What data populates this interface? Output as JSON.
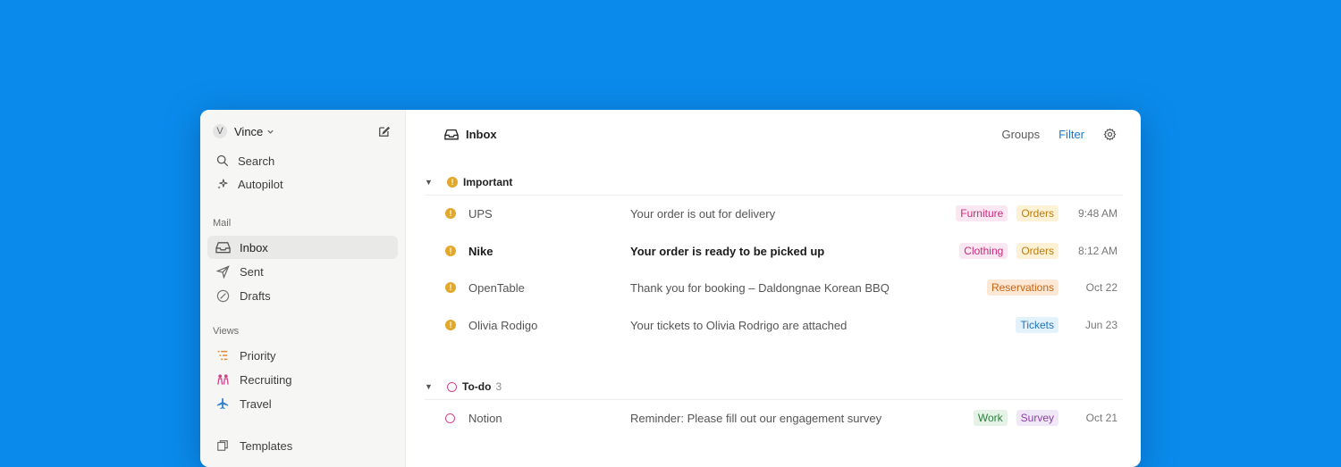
{
  "sidebar": {
    "account_initial": "V",
    "account_name": "Vince",
    "top_items": [
      {
        "label": "Search",
        "icon": "search-icon"
      },
      {
        "label": "Autopilot",
        "icon": "sparkle-icon"
      }
    ],
    "mail_section": "Mail",
    "mail_items": [
      {
        "label": "Inbox",
        "icon": "inbox-icon",
        "active": true
      },
      {
        "label": "Sent",
        "icon": "send-icon"
      },
      {
        "label": "Drafts",
        "icon": "drafts-icon"
      }
    ],
    "views_section": "Views",
    "view_items": [
      {
        "label": "Priority",
        "icon": "priority-icon"
      },
      {
        "label": "Recruiting",
        "icon": "people-icon"
      },
      {
        "label": "Travel",
        "icon": "plane-icon"
      }
    ],
    "templates_label": "Templates"
  },
  "header": {
    "title": "Inbox",
    "groups_label": "Groups",
    "filter_label": "Filter"
  },
  "groups": [
    {
      "name": "Important",
      "count": "",
      "rows": [
        {
          "sender": "UPS",
          "subject": "Your order is out for delivery",
          "tags": [
            "Furniture",
            "Orders"
          ],
          "time": "9:48 AM",
          "unread": false
        },
        {
          "sender": "Nike",
          "subject": "Your order is ready to be picked up",
          "tags": [
            "Clothing",
            "Orders"
          ],
          "time": "8:12 AM",
          "unread": true
        },
        {
          "sender": "OpenTable",
          "subject": "Thank you for booking – Daldongnae Korean BBQ",
          "tags": [
            "Reservations"
          ],
          "time": "Oct 22",
          "unread": false
        },
        {
          "sender": "Olivia Rodigo",
          "subject": "Your tickets to Olivia Rodrigo are attached",
          "tags": [
            "Tickets"
          ],
          "time": "Jun 23",
          "unread": false
        }
      ]
    },
    {
      "name": "To-do",
      "count": "3",
      "rows": [
        {
          "sender": "Notion",
          "subject": "Reminder: Please fill out our engagement survey",
          "tags": [
            "Work",
            "Survey"
          ],
          "time": "Oct 21",
          "unread": false
        }
      ]
    }
  ],
  "tag_colors": {
    "Furniture": {
      "bg": "#fbe7f1",
      "fg": "#c42c7c"
    },
    "Orders": {
      "bg": "#fdf1d6",
      "fg": "#c07d0c"
    },
    "Clothing": {
      "bg": "#fbe7f1",
      "fg": "#c42c7c"
    },
    "Reservations": {
      "bg": "#fde8d6",
      "fg": "#c9610f"
    },
    "Tickets": {
      "bg": "#e3f1fb",
      "fg": "#2174b8"
    },
    "Work": {
      "bg": "#e4f3e6",
      "fg": "#2e7d3c"
    },
    "Survey": {
      "bg": "#f1e8f7",
      "fg": "#8a3fa8"
    }
  },
  "colors": {
    "background": "#0a8bec",
    "important": "#e1a82b",
    "todo": "#d1438b",
    "filter_link": "#1a78c8"
  }
}
